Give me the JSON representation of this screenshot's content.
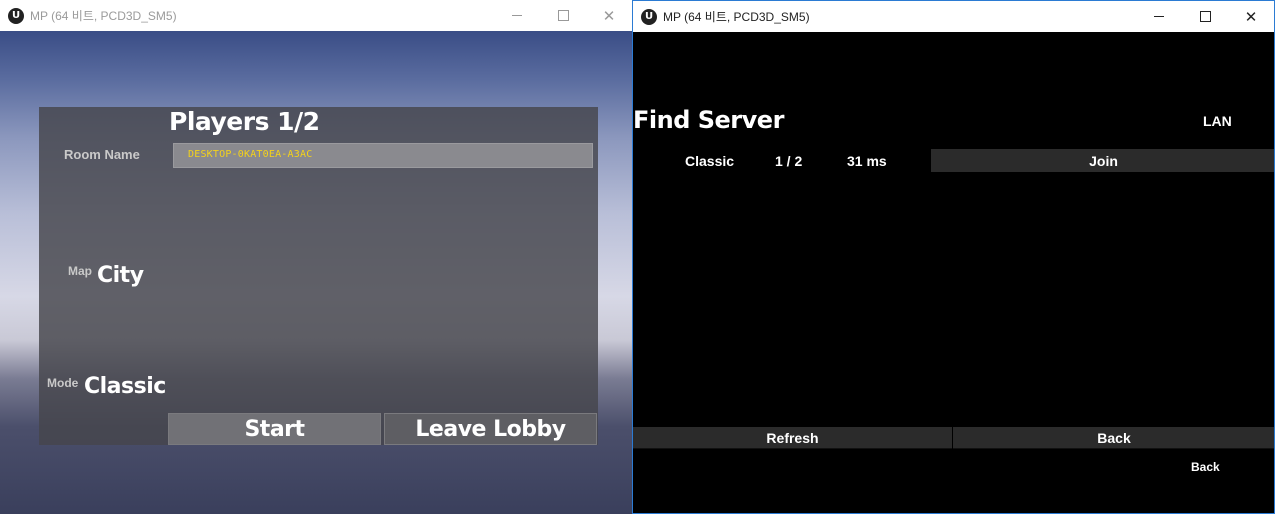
{
  "left_window": {
    "title": "MP (64 비트, PCD3D_SM5)",
    "icon": "unreal-engine-icon",
    "controls": {
      "minimize": "minimize-icon",
      "maximize": "maximize-icon",
      "close": "close-icon",
      "close_glyph": "✕"
    },
    "lobby": {
      "players_title": "Players 1/2",
      "room_name_label": "Room Name",
      "room_name_value": "DESKTOP-0KAT0EA-A3AC",
      "map_label": "Map",
      "map_value": "City",
      "mode_label": "Mode",
      "mode_value": "Classic",
      "start_button": "Start",
      "leave_button": "Leave Lobby"
    },
    "colors": {
      "room_name_text": "#f4d21a",
      "panel_bg": "#46464c"
    }
  },
  "right_window": {
    "title": "MP (64 비트, PCD3D_SM5)",
    "icon": "unreal-engine-icon",
    "controls": {
      "minimize": "minimize-icon",
      "maximize": "maximize-icon",
      "close": "close-icon",
      "close_glyph": "✕"
    },
    "find_server": {
      "title": "Find Server",
      "lan_label": "LAN",
      "servers": [
        {
          "mode": "Classic",
          "players": "1 / 2",
          "ping": "31 ms",
          "join_label": "Join"
        }
      ],
      "refresh_button": "Refresh",
      "back_button": "Back",
      "back_link": "Back"
    },
    "colors": {
      "accent_border": "#2b7bd3",
      "button_bg": "#2b2b2b"
    }
  },
  "app_icon_glyph": "U"
}
